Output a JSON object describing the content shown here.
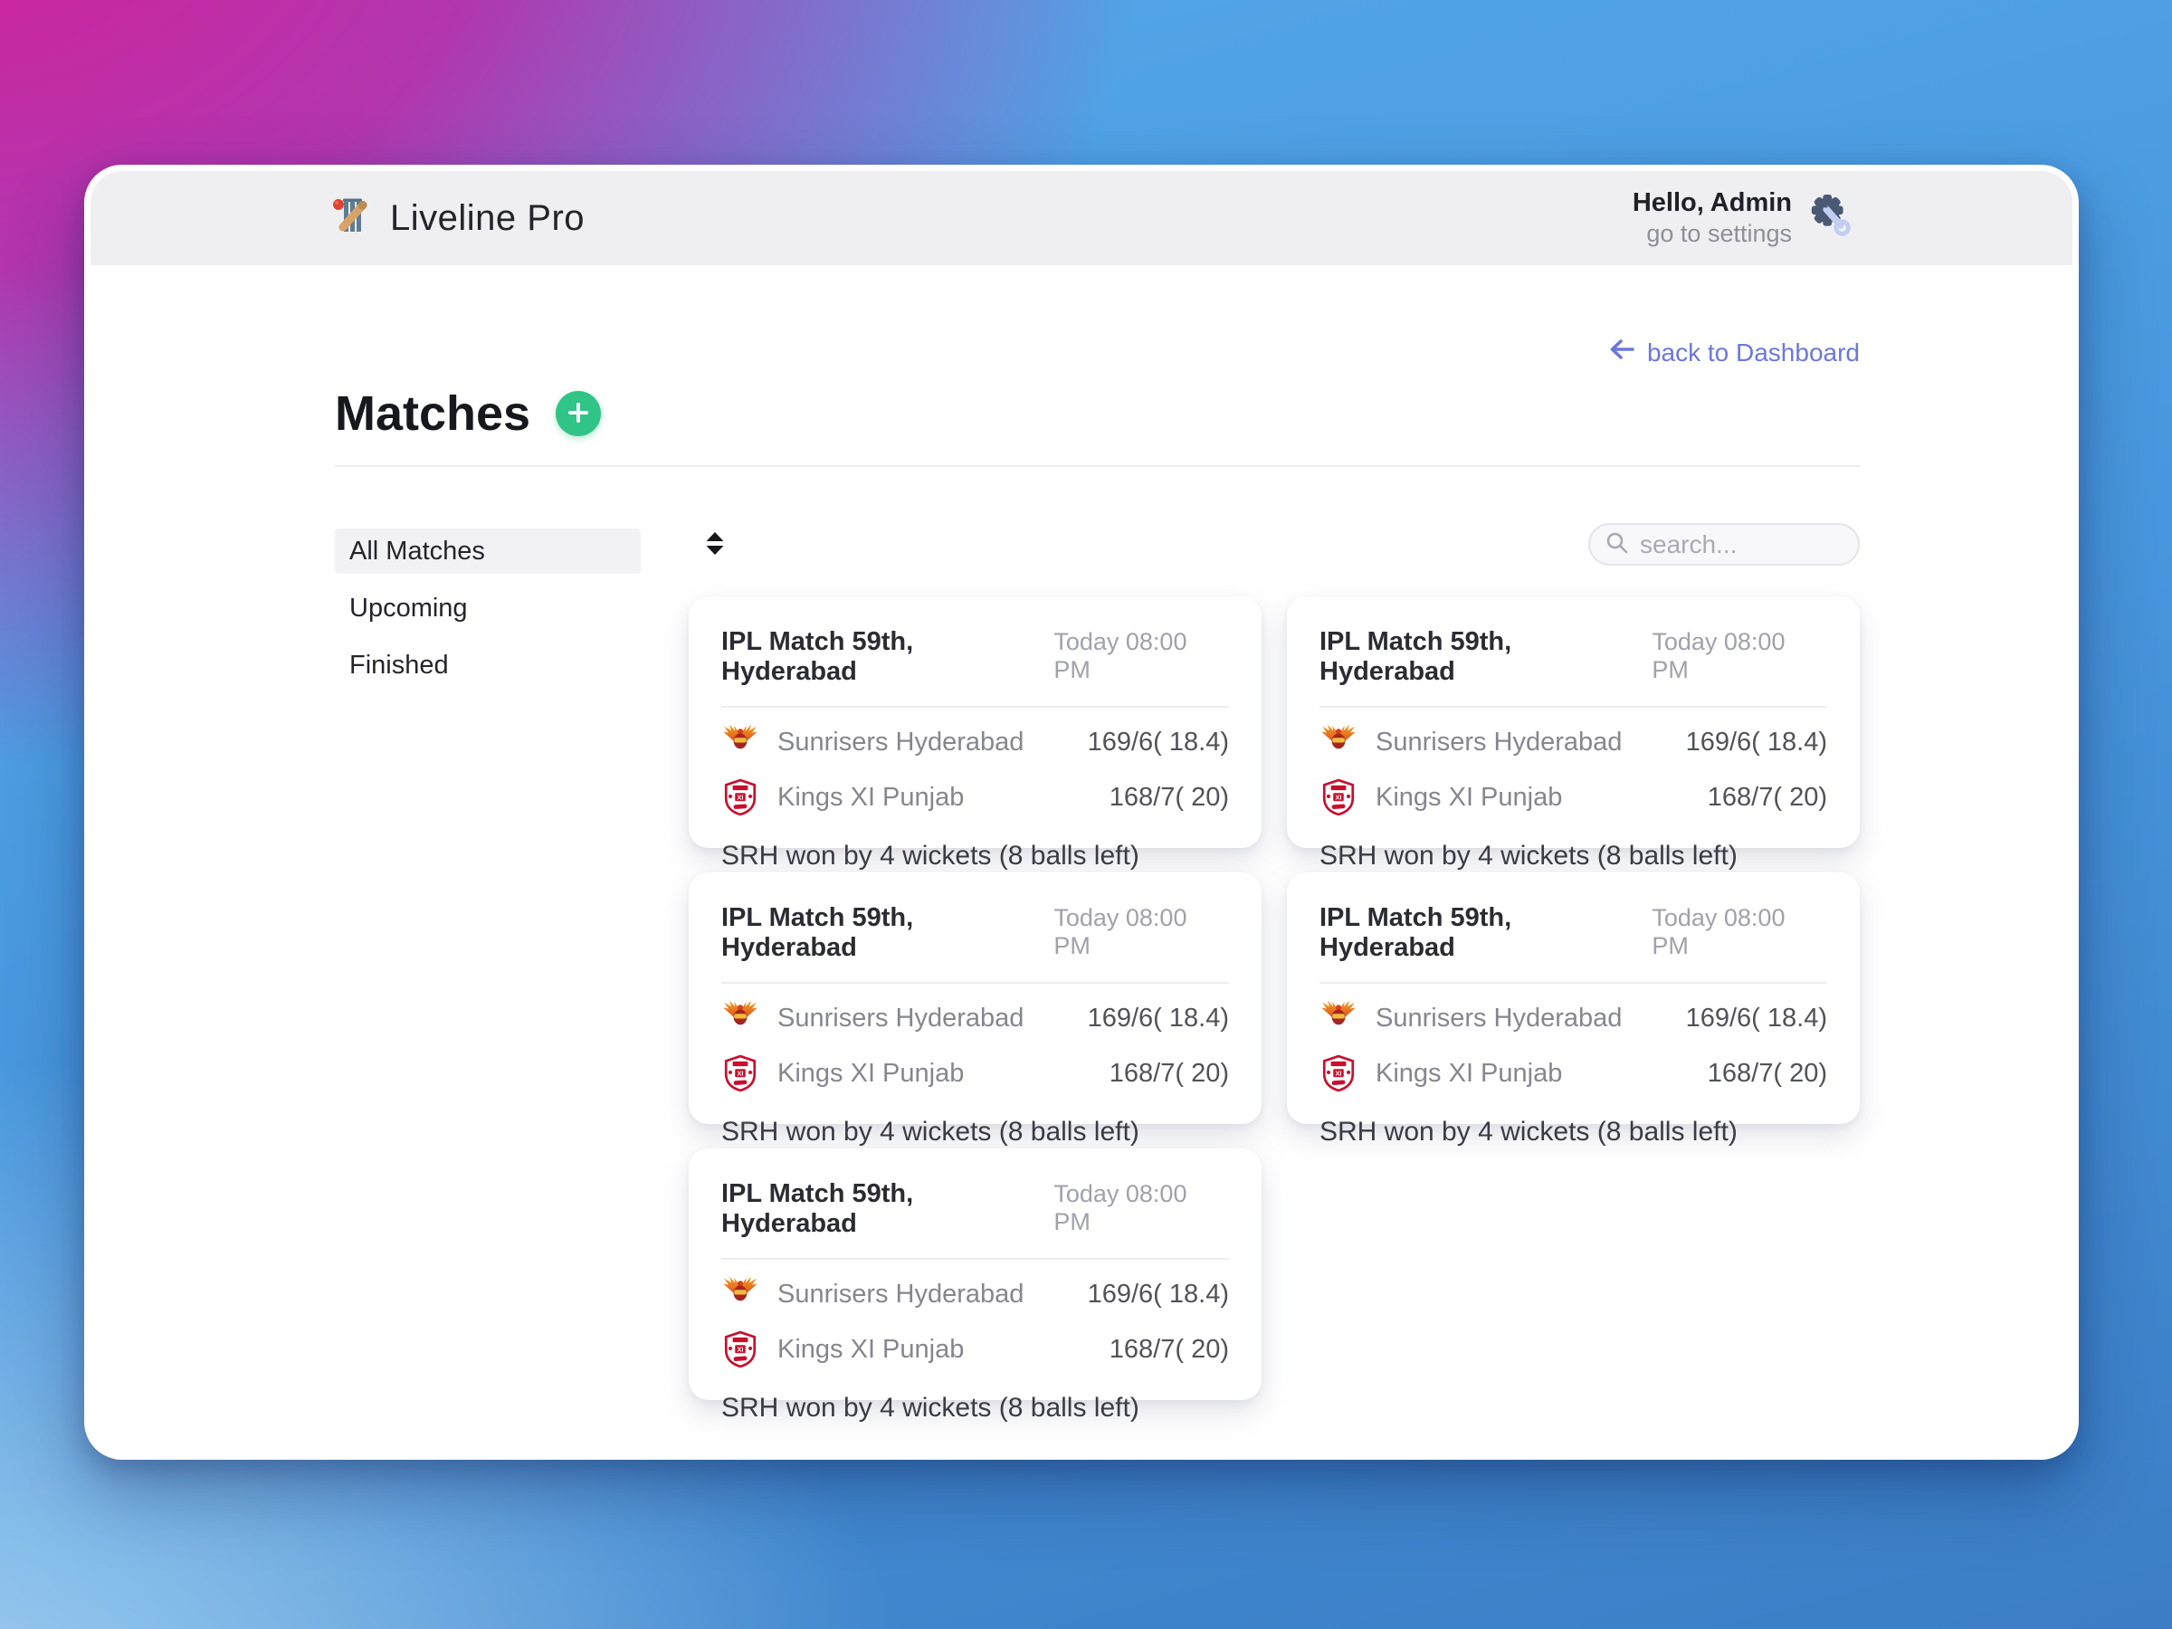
{
  "header": {
    "brand": "Liveline Pro",
    "greeting": "Hello, Admin",
    "settings_label": "go to settings"
  },
  "back_link": "back to Dashboard",
  "page_title": "Matches",
  "sidebar": {
    "items": [
      {
        "label": "All Matches",
        "active": true
      },
      {
        "label": "Upcoming",
        "active": false
      },
      {
        "label": "Finished",
        "active": false
      }
    ]
  },
  "search": {
    "placeholder": "search..."
  },
  "matches": [
    {
      "title": "IPL Match 59th, Hyderabad",
      "time": "Today 08:00 PM",
      "teams": [
        {
          "name": "Sunrisers Hyderabad",
          "score": "169/6( 18.4)",
          "logo": "srh-logo"
        },
        {
          "name": "Kings XI Punjab",
          "score": "168/7( 20)",
          "logo": "kxip-logo"
        }
      ],
      "result": "SRH won by 4 wickets (8 balls left)"
    },
    {
      "title": "IPL Match 59th, Hyderabad",
      "time": "Today 08:00 PM",
      "teams": [
        {
          "name": "Sunrisers Hyderabad",
          "score": "169/6( 18.4)",
          "logo": "srh-logo"
        },
        {
          "name": "Kings XI Punjab",
          "score": "168/7( 20)",
          "logo": "kxip-logo"
        }
      ],
      "result": "SRH won by 4 wickets (8 balls left)"
    },
    {
      "title": "IPL Match 59th, Hyderabad",
      "time": "Today 08:00 PM",
      "teams": [
        {
          "name": "Sunrisers Hyderabad",
          "score": "169/6( 18.4)",
          "logo": "srh-logo"
        },
        {
          "name": "Kings XI Punjab",
          "score": "168/7( 20)",
          "logo": "kxip-logo"
        }
      ],
      "result": "SRH won by 4 wickets (8 balls left)"
    },
    {
      "title": "IPL Match 59th, Hyderabad",
      "time": "Today 08:00 PM",
      "teams": [
        {
          "name": "Sunrisers Hyderabad",
          "score": "169/6( 18.4)",
          "logo": "srh-logo"
        },
        {
          "name": "Kings XI Punjab",
          "score": "168/7( 20)",
          "logo": "kxip-logo"
        }
      ],
      "result": "SRH won by 4 wickets (8 balls left)"
    },
    {
      "title": "IPL Match 59th, Hyderabad",
      "time": "Today 08:00 PM",
      "teams": [
        {
          "name": "Sunrisers Hyderabad",
          "score": "169/6( 18.4)",
          "logo": "srh-logo"
        },
        {
          "name": "Kings XI Punjab",
          "score": "168/7( 20)",
          "logo": "kxip-logo"
        }
      ],
      "result": "SRH won by 4 wickets (8 balls left)"
    }
  ],
  "colors": {
    "accent_green": "#30c487",
    "link_blue": "#6a78dd",
    "header_bg": "#efeff1",
    "srh_orange": "#f6a21e",
    "kxip_red": "#c8102e"
  }
}
